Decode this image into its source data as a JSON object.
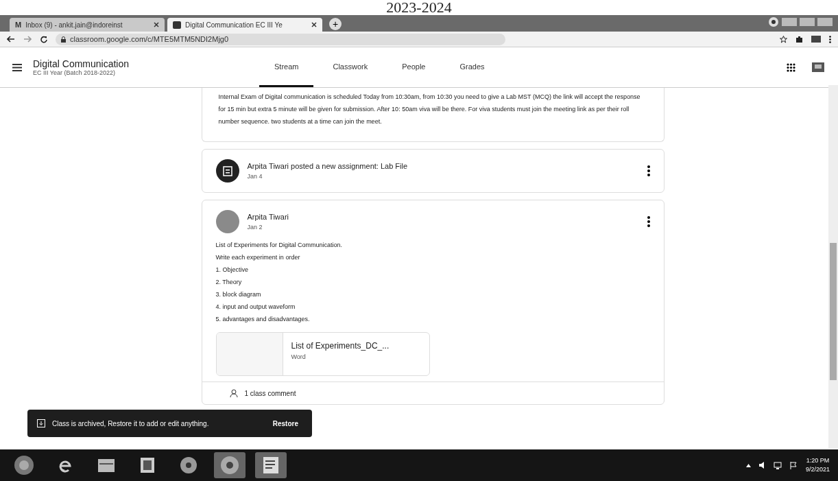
{
  "page_header": "2023-2024",
  "browser": {
    "tabs": [
      {
        "favicon": "M",
        "title": "Inbox (9) - ankit.jain@indoreinst",
        "selected": false
      },
      {
        "title": "Digital Communication EC III Ye",
        "selected": true
      }
    ],
    "new_tab": "+",
    "url": "classroom.google.com/c/MTE5MTM5NDI2Mjg0"
  },
  "classroom": {
    "title": "Digital Communication",
    "subtitle": "EC III Year (Batch 2018-2022)",
    "nav": [
      {
        "label": "Stream",
        "selected": true
      },
      {
        "label": "Classwork",
        "selected": false
      },
      {
        "label": "People",
        "selected": false
      },
      {
        "label": "Grades",
        "selected": false
      }
    ]
  },
  "stream": {
    "announcement": "Internal Exam of Digital communication is scheduled Today from 10:30am, from 10:30 you need to give a Lab MST (MCQ) the link will accept the response for 15 min but extra 5 minute will be given for submission. After 10: 50am viva will be there. For viva students must join the meeting link as per their roll number sequence. two students at a time can join the meet.",
    "assignment": {
      "title": "Arpita Tiwari posted a new assignment: Lab File",
      "date": "Jan 4"
    },
    "post": {
      "author": "Arpita Tiwari",
      "date": "Jan 2",
      "lines": [
        "List of Experiments for Digital Communication.",
        "Write each experiment in order",
        "1. Objective",
        "2. Theory",
        "3. block diagram",
        "4. input and output waveform",
        "5. advantages and disadvantages."
      ],
      "attachment": {
        "name": "List of Experiments_DC_...",
        "type": "Word"
      },
      "comments": "1 class comment"
    }
  },
  "snackbar": {
    "message": "Class is archived, Restore it to add or edit anything.",
    "action": "Restore"
  },
  "taskbar": {
    "apps": [
      {
        "kind": "start",
        "active": false
      },
      {
        "kind": "ie",
        "active": false
      },
      {
        "kind": "folder",
        "active": false
      },
      {
        "kind": "media",
        "active": false
      },
      {
        "kind": "disc",
        "active": false
      },
      {
        "kind": "chrome",
        "active": true
      },
      {
        "kind": "word",
        "active": true
      }
    ],
    "time": "1:20 PM",
    "date": "9/2/2021"
  }
}
